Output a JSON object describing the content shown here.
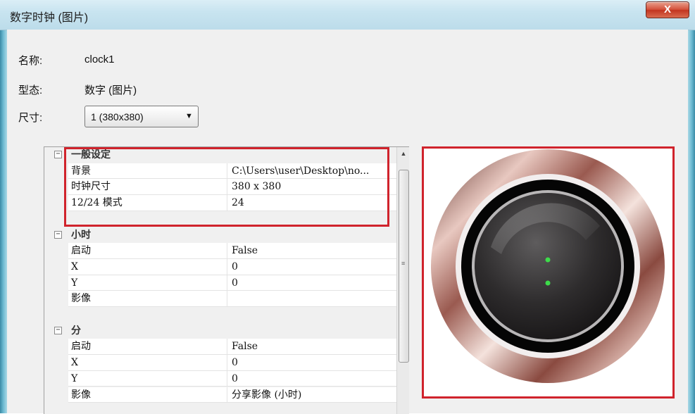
{
  "window": {
    "title": "数字时钟 (图片)",
    "close_label": "X"
  },
  "info": {
    "name_label": "名称:",
    "name_value": "clock1",
    "type_label": "型态:",
    "type_value": "数字 (图片)",
    "size_label": "尺寸:",
    "size_selected": "1  (380x380)"
  },
  "property_grid": {
    "categories": [
      {
        "name": "一般设定",
        "rows": [
          {
            "name": "背景",
            "value": "C:\\Users\\user\\Desktop\\no..."
          },
          {
            "name": "时钟尺寸",
            "value": "380 x 380"
          },
          {
            "name": "12/24 模式",
            "value": "24"
          }
        ]
      },
      {
        "name": "小时",
        "rows": [
          {
            "name": "启动",
            "value": "False"
          },
          {
            "name": "X",
            "value": "0"
          },
          {
            "name": "Y",
            "value": "0"
          },
          {
            "name": "影像",
            "value": ""
          }
        ]
      },
      {
        "name": "分",
        "rows": [
          {
            "name": "启动",
            "value": "False"
          },
          {
            "name": "X",
            "value": "0"
          },
          {
            "name": "Y",
            "value": "0"
          },
          {
            "name": "影像",
            "value": "分享影像 (小时)"
          }
        ]
      }
    ]
  },
  "colors": {
    "highlight": "#d0232c",
    "clock_dot": "#3ddc4a"
  }
}
